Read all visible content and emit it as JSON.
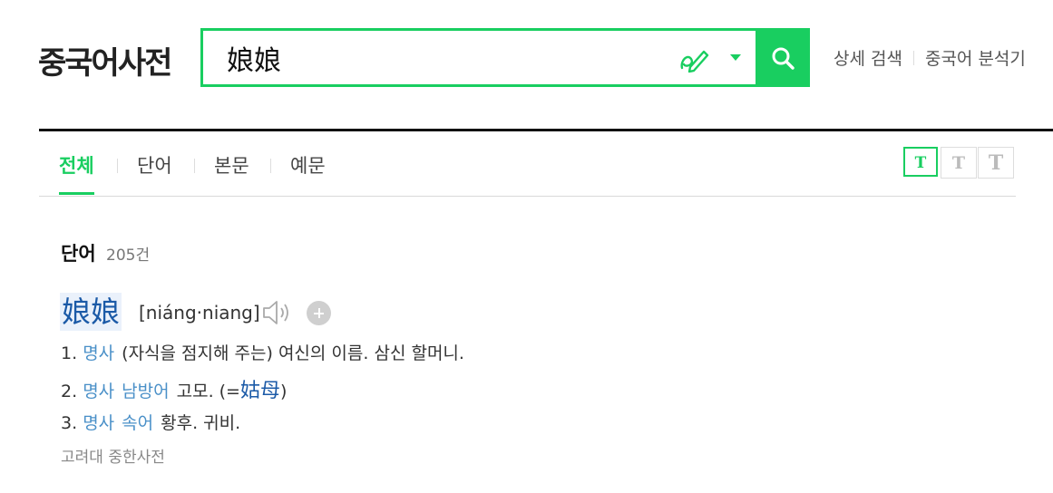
{
  "header": {
    "logo": "중국어사전",
    "search": {
      "value": "娘娘"
    },
    "links": [
      "상세 검색",
      "중국어 분석기"
    ]
  },
  "icons": {
    "handwrite": "handwriting-pen-icon",
    "dropdown": "chevron-down-icon",
    "search": "search-icon",
    "speaker": "speaker-icon",
    "add": "plus-circle-icon"
  },
  "colors": {
    "accent": "#19ce60",
    "link": "#1b5aa7",
    "pos": "#4a90c8"
  },
  "tabs": [
    {
      "label": "전체",
      "active": true
    },
    {
      "label": "단어",
      "active": false
    },
    {
      "label": "본문",
      "active": false
    },
    {
      "label": "예문",
      "active": false
    }
  ],
  "font_size_buttons": [
    "T",
    "T",
    "T"
  ],
  "section": {
    "title": "단어",
    "count": "205건"
  },
  "entry": {
    "word": "娘娘",
    "pinyin": "[niáng·niang]",
    "definitions": [
      {
        "num": "1.",
        "pos": "명사",
        "region": "",
        "text": "(자식을 점지해 주는) 여신의 이름. 삼신 할머니.",
        "prefix": "",
        "link": "",
        "suffix": ""
      },
      {
        "num": "2.",
        "pos": "명사",
        "region": "남방어",
        "text": "고모. (=",
        "link": "姑母",
        "suffix": ")"
      },
      {
        "num": "3.",
        "pos": "명사",
        "region": "속어",
        "text": "황후. 귀비.",
        "link": "",
        "suffix": ""
      }
    ],
    "source": "고려대 중한사전"
  }
}
